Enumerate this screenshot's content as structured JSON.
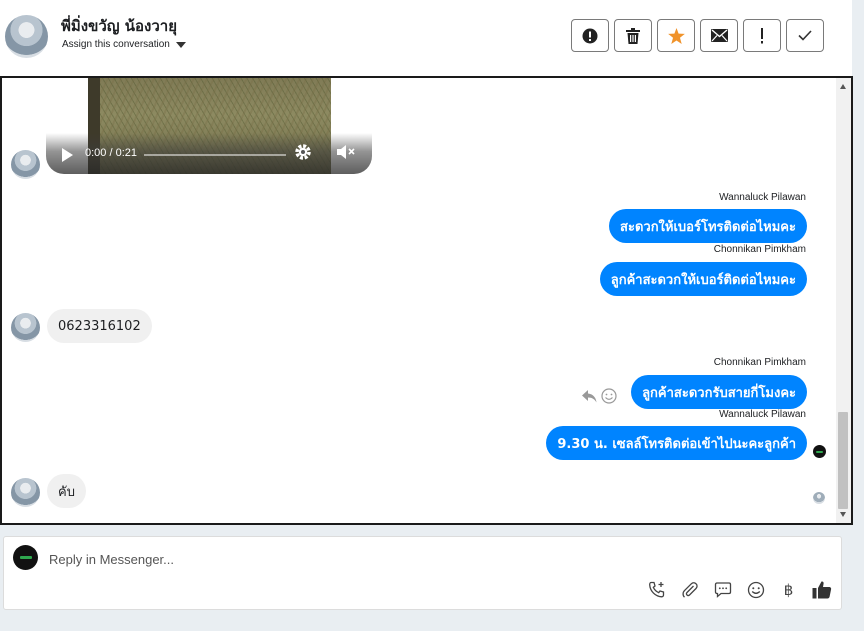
{
  "header": {
    "contact_name": "พี่มิ่งขวัญ น้องวายุ",
    "assign_label": "Assign this conversation",
    "toolbar": [
      {
        "name": "alert-button",
        "icon": "exclamation-circle-icon"
      },
      {
        "name": "delete-button",
        "icon": "trash-icon"
      },
      {
        "name": "star-button",
        "icon": "star-icon",
        "color": "#f0932b"
      },
      {
        "name": "mail-button",
        "icon": "envelope-icon"
      },
      {
        "name": "important-button",
        "icon": "exclamation-icon"
      },
      {
        "name": "done-button",
        "icon": "check-icon"
      }
    ]
  },
  "conversation": {
    "video": {
      "time": "0:00 / 0:21"
    },
    "messages": [
      {
        "sender": "Wannaluck Pilawan",
        "text": "สะดวกให้เบอร์โทรติดต่อไหมคะ",
        "direction": "out"
      },
      {
        "sender": "Chonnikan Pimkham",
        "text": "ลูกค้าสะดวกให้เบอร์ติดต่อไหมคะ",
        "direction": "out"
      },
      {
        "text": "0623316102",
        "direction": "in"
      },
      {
        "sender": "Chonnikan Pimkham",
        "text": "ลูกค้าสะดวกรับสายกี่โมงคะ",
        "direction": "out"
      },
      {
        "sender": "Wannaluck Pilawan",
        "text": "9.30  น.  เซลล์โทรติดต่อเข้าไปนะคะลูกค้า",
        "direction": "out"
      },
      {
        "text": "คับ",
        "direction": "in"
      }
    ]
  },
  "reply": {
    "placeholder": "Reply in Messenger...",
    "tools": [
      "phone-plus-icon",
      "paperclip-icon",
      "speech-bubble-icon",
      "smiley-icon",
      "baht-icon",
      "thumbs-up-icon"
    ],
    "baht_symbol": "฿"
  },
  "colors": {
    "bubble_out": "#0084ff",
    "bubble_in": "#f0f0f0",
    "star": "#f0932b"
  }
}
